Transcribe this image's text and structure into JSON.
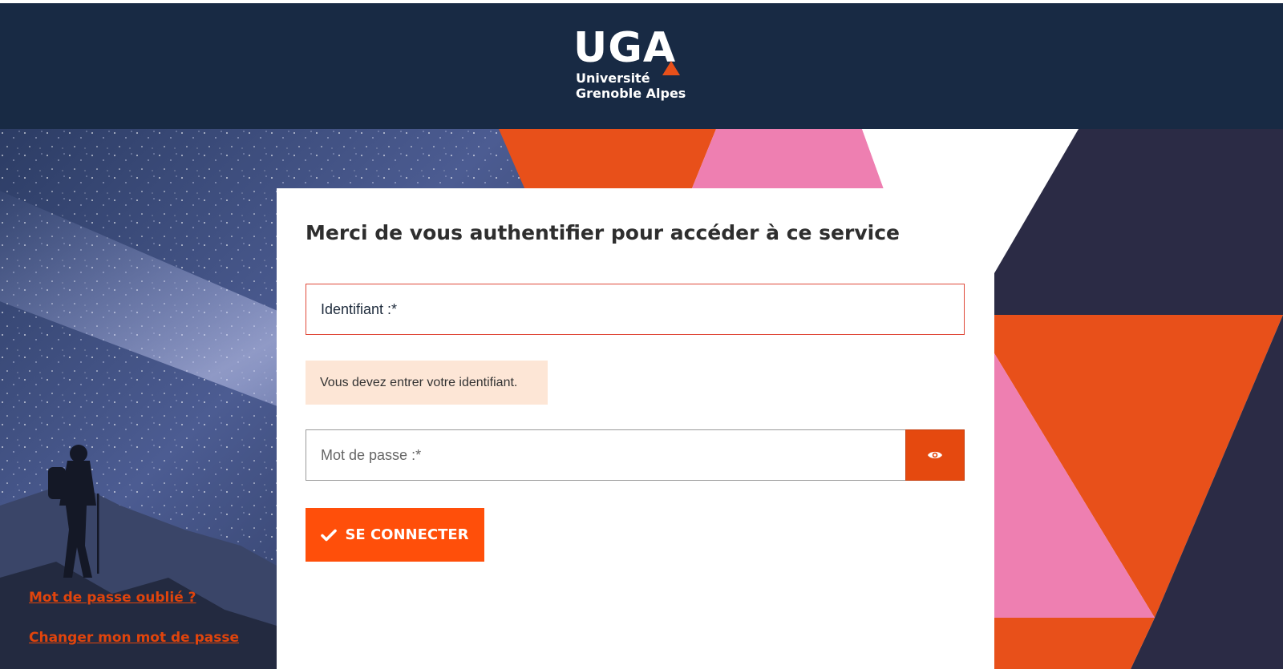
{
  "header": {
    "logo": {
      "mark": "UGA",
      "line1": "Université",
      "line2": "Grenoble Alpes"
    }
  },
  "login": {
    "title": "Merci de vous authentifier pour accéder à ce service",
    "username_placeholder": "Identifiant :*",
    "username_error": "Vous devez entrer votre identifiant.",
    "password_placeholder": "Mot de passe :*",
    "show_password_icon": "eye-icon",
    "submit_icon": "check-icon",
    "submit_label": "SE CONNECTER",
    "forgot_password_link": "Mot de passe oublié ?",
    "change_password_link": "Changer mon mot de passe"
  },
  "colors": {
    "header_background": "#182a44",
    "accent_orange": "#ff4f0a",
    "error_border": "#e04a3a",
    "error_background": "#fde6d6",
    "pink": "#ee7fb1",
    "navy": "#2b2b45"
  }
}
